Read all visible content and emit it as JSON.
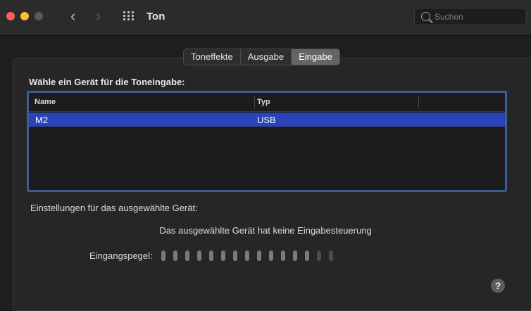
{
  "window": {
    "title": "Ton",
    "search": {
      "placeholder": "Suchen",
      "value": ""
    }
  },
  "icons": {
    "back": "chevron-left-icon",
    "forward": "chevron-right-icon",
    "grid": "show-all-grid-icon",
    "search": "search-icon",
    "help": "help-icon"
  },
  "tabs": [
    {
      "label": "Toneffekte",
      "active": false
    },
    {
      "label": "Ausgabe",
      "active": false
    },
    {
      "label": "Eingabe",
      "active": true
    }
  ],
  "input": {
    "heading": "Wähle ein Gerät für die Toneingabe:",
    "table": {
      "columns": [
        "Name",
        "Typ"
      ],
      "rows": [
        {
          "name": "M2",
          "type": "USB",
          "selected": true
        }
      ]
    },
    "settings_label": "Einstellungen für das ausgewählte Gerät:",
    "no_control_text": "Das ausgewählte Gerät hat keine Eingabesteuerung",
    "level_label": "Eingangspegel:",
    "level": {
      "segments_total": 15,
      "segments_lit": 13
    }
  },
  "help": {
    "label": "?"
  },
  "colors": {
    "selection": "#2a43b6",
    "focus_ring": "#3c5e92",
    "close": "#fe5f57",
    "minimize": "#febc2e"
  }
}
